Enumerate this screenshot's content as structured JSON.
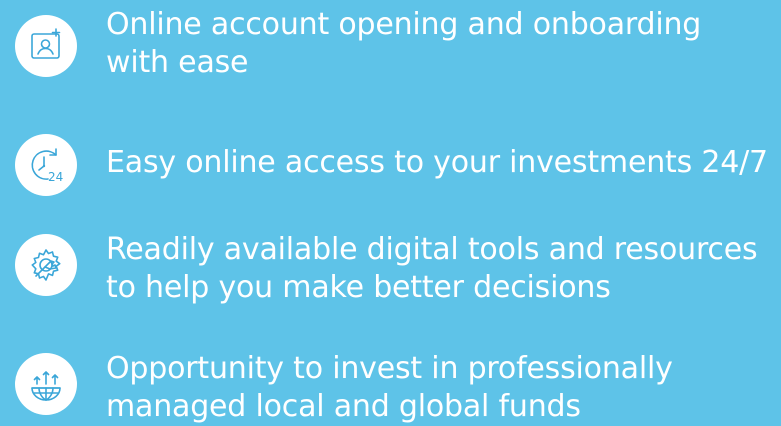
{
  "colors": {
    "background": "#5ec3e8",
    "icon_circle": "#ffffff",
    "icon_stroke": "#3aa6d8",
    "text": "#ffffff"
  },
  "features": [
    {
      "icon": "profile-card-icon",
      "lines": [
        "Online account opening and onboarding",
        "with ease"
      ]
    },
    {
      "icon": "clock-24-icon",
      "icon_label": "24",
      "lines": [
        "Easy online access to your investments 24/7"
      ]
    },
    {
      "icon": "gear-tools-icon",
      "lines": [
        "Readily available digital tools and resources",
        "to help you make better decisions"
      ]
    },
    {
      "icon": "globe-growth-icon",
      "lines": [
        "Opportunity to invest in professionally",
        "managed local and global funds"
      ]
    }
  ]
}
